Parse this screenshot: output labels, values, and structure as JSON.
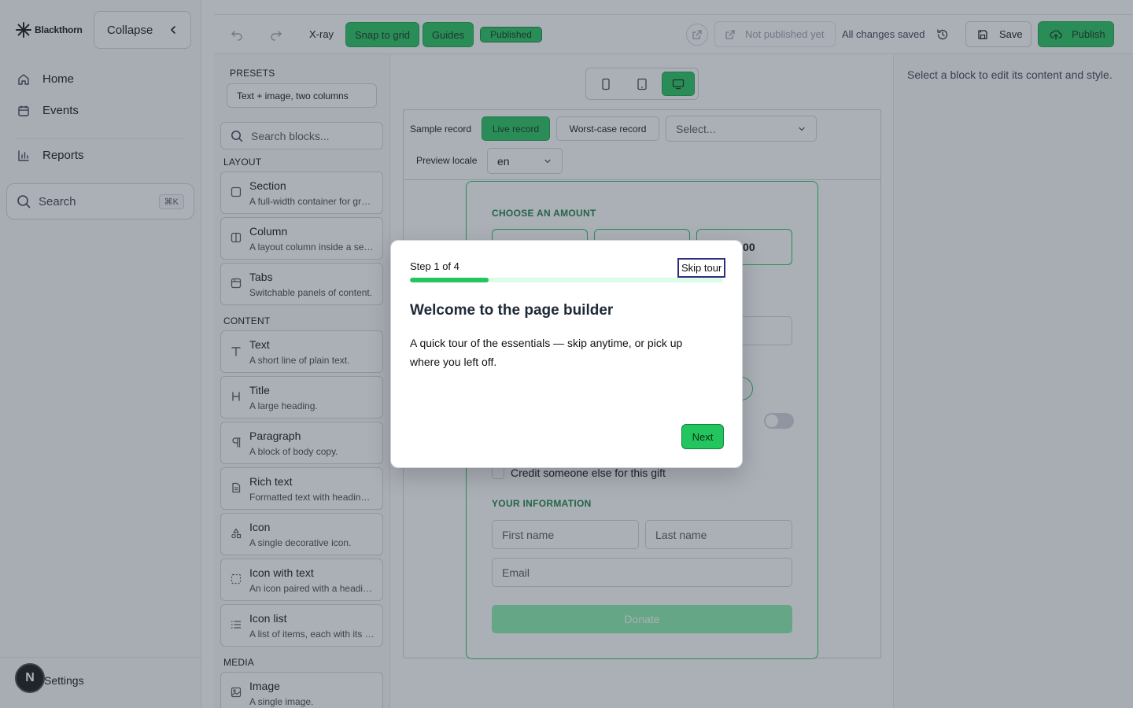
{
  "brand": {
    "name": "Blackthorn"
  },
  "sidebar": {
    "collapse_label": "Collapse",
    "items": [
      {
        "label": "Home",
        "icon": "home-icon"
      },
      {
        "label": "Events",
        "icon": "calendar-icon"
      },
      {
        "label": "Reports",
        "icon": "bar-chart-icon"
      }
    ],
    "search_label": "Search",
    "search_shortcut": "⌘K",
    "settings_label": "Settings",
    "avatar_letter": "N"
  },
  "toolbar": {
    "xray_label": "X-ray",
    "snap_label": "Snap to grid",
    "guides_label": "Guides",
    "status_badge": "Published",
    "not_published_label": "Not published yet",
    "saved_status": "All changes saved",
    "save_label": "Save",
    "publish_label": "Publish"
  },
  "blocks_panel": {
    "presets_heading": "PRESETS",
    "preset_value": "Text + image, two columns",
    "search_placeholder": "Search blocks...",
    "layout_heading": "LAYOUT",
    "content_heading": "CONTENT",
    "media_heading": "MEDIA",
    "layout_blocks": [
      {
        "title": "Section",
        "desc": "A full-width container for grouping blocks.",
        "icon": "square-icon"
      },
      {
        "title": "Column",
        "desc": "A layout column inside a section.",
        "icon": "columns-icon"
      },
      {
        "title": "Tabs",
        "desc": "Switchable panels of content.",
        "icon": "tabs-icon"
      }
    ],
    "content_blocks": [
      {
        "title": "Text",
        "desc": "A short line of plain text.",
        "icon": "text-icon"
      },
      {
        "title": "Title",
        "desc": "A large heading.",
        "icon": "heading-icon"
      },
      {
        "title": "Paragraph",
        "desc": "A block of body copy.",
        "icon": "pilcrow-icon"
      },
      {
        "title": "Rich text",
        "desc": "Formatted text with headings and lists.",
        "icon": "document-icon"
      },
      {
        "title": "Icon",
        "desc": "A single decorative icon.",
        "icon": "shapes-icon"
      },
      {
        "title": "Icon with text",
        "desc": "An icon paired with a heading and text.",
        "icon": "dashed-square-icon"
      },
      {
        "title": "Icon list",
        "desc": "A list of items, each with its own icon.",
        "icon": "list-icon"
      }
    ],
    "media_blocks": [
      {
        "title": "Image",
        "desc": "A single image.",
        "icon": "image-icon"
      }
    ]
  },
  "canvas": {
    "sample_record_label": "Sample record",
    "live_record_label": "Live record",
    "worst_case_label": "Worst-case record",
    "record_select_placeholder": "Select...",
    "preview_locale_label": "Preview locale",
    "locale_value": "en",
    "form": {
      "choose_amount_heading": "CHOOSE AN AMOUNT",
      "amount_visible_fragment": "0.00",
      "credit_label": "Credit someone else for this gift",
      "your_info_heading": "YOUR INFORMATION",
      "first_name_placeholder": "First name",
      "last_name_placeholder": "Last name",
      "email_placeholder": "Email",
      "donate_label": "Donate"
    }
  },
  "inspector": {
    "hint": "Select a block to edit its content and style."
  },
  "tour": {
    "step_label": "Step 1 of 4",
    "skip_label": "Skip tour",
    "progress_fraction": 0.25,
    "title": "Welcome to the page builder",
    "body": "A quick tour of the essentials — skip anytime, or pick up where you left off.",
    "next_label": "Next"
  },
  "colors": {
    "accent": "#22c55e",
    "accent_dark": "#15803d",
    "overlay": "#374151",
    "focus_ring": "#312e81"
  }
}
